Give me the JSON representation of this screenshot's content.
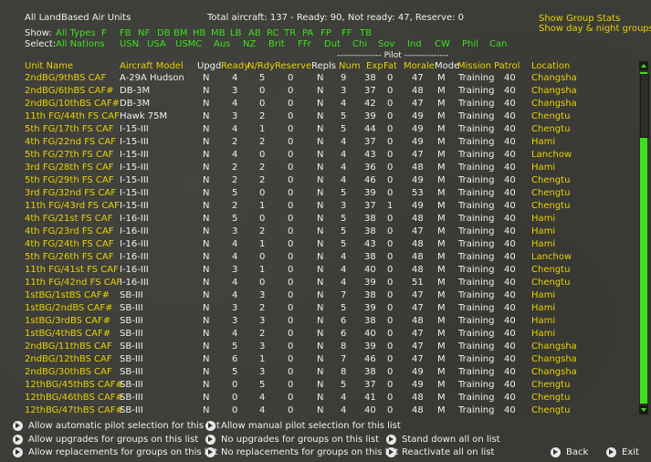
{
  "header": {
    "title": "All LandBased Air Units",
    "summary": "Total aircraft: 137 - Ready: 90, Not ready: 47, Reserve: 0",
    "show_group_stats": "Show Group Stats",
    "show_day_night": "Show day & night groups",
    "show_label": "Show:",
    "select_label": "Select:",
    "show_filters": [
      "All Types",
      "F",
      "FB",
      "NF",
      "DB",
      "BM",
      "HB",
      "MB",
      "LB",
      "AB",
      "RC",
      "TR",
      "PA",
      "FP",
      "FF",
      "TB"
    ],
    "select_filters": [
      "All Nations",
      "USN",
      "USA",
      "USMC",
      "Aus",
      "NZ",
      "Brit",
      "FFr",
      "Dut",
      "Chi",
      "Sov",
      "Ind",
      "CW",
      "Phil",
      "Can"
    ],
    "pilot_group": "--------------- Pilot ---------------"
  },
  "columns": {
    "unit": "Unit Name",
    "aircraft": "Aircraft Model",
    "upgd": "Upgd",
    "ready": "Ready",
    "nrdy": "N/Rdy",
    "reserve": "Reserve",
    "repls": "Repls",
    "num": "Num",
    "exp": "Exp",
    "fat": "Fat",
    "morale": "Morale",
    "mode": "Mode",
    "mission": "Mission",
    "patrol": "Patrol",
    "location": "Location"
  },
  "rows": [
    {
      "unit": "2ndBG/9thBS CAF",
      "aircraft": "A-29A Hudson",
      "upgd": "N",
      "ready": "4",
      "nrdy": "5",
      "reserve": "0",
      "repls": "N",
      "num": "9",
      "exp": "38",
      "fat": "0",
      "morale": "47",
      "mode": "M",
      "mission": "Training",
      "patrol": "40",
      "location": "Changsha"
    },
    {
      "unit": "2ndBG/6thBS CAF#",
      "aircraft": "DB-3M",
      "upgd": "N",
      "ready": "3",
      "nrdy": "0",
      "reserve": "0",
      "repls": "N",
      "num": "3",
      "exp": "37",
      "fat": "0",
      "morale": "48",
      "mode": "M",
      "mission": "Training",
      "patrol": "40",
      "location": "Changsha"
    },
    {
      "unit": "2ndBG/10thBS CAF#",
      "aircraft": "DB-3M",
      "upgd": "N",
      "ready": "4",
      "nrdy": "0",
      "reserve": "0",
      "repls": "N",
      "num": "4",
      "exp": "42",
      "fat": "0",
      "morale": "47",
      "mode": "M",
      "mission": "Training",
      "patrol": "40",
      "location": "Changsha"
    },
    {
      "unit": "11th FG/44th FS CAF",
      "aircraft": "Hawk 75M",
      "upgd": "N",
      "ready": "3",
      "nrdy": "2",
      "reserve": "0",
      "repls": "N",
      "num": "5",
      "exp": "39",
      "fat": "0",
      "morale": "49",
      "mode": "M",
      "mission": "Training",
      "patrol": "40",
      "location": "Chengtu"
    },
    {
      "unit": "5th FG/17th FS CAF",
      "aircraft": "I-15-III",
      "upgd": "N",
      "ready": "4",
      "nrdy": "1",
      "reserve": "0",
      "repls": "N",
      "num": "5",
      "exp": "44",
      "fat": "0",
      "morale": "49",
      "mode": "M",
      "mission": "Training",
      "patrol": "40",
      "location": "Chengtu"
    },
    {
      "unit": "4th FG/22nd FS CAF",
      "aircraft": "I-15-III",
      "upgd": "N",
      "ready": "2",
      "nrdy": "2",
      "reserve": "0",
      "repls": "N",
      "num": "4",
      "exp": "37",
      "fat": "0",
      "morale": "49",
      "mode": "M",
      "mission": "Training",
      "patrol": "40",
      "location": "Hami"
    },
    {
      "unit": "5th FG/27th FS CAF",
      "aircraft": "I-15-III",
      "upgd": "N",
      "ready": "4",
      "nrdy": "0",
      "reserve": "0",
      "repls": "N",
      "num": "4",
      "exp": "43",
      "fat": "0",
      "morale": "47",
      "mode": "M",
      "mission": "Training",
      "patrol": "40",
      "location": "Lanchow"
    },
    {
      "unit": "3rd FG/28th FS CAF",
      "aircraft": "I-15-III",
      "upgd": "N",
      "ready": "2",
      "nrdy": "2",
      "reserve": "0",
      "repls": "N",
      "num": "4",
      "exp": "36",
      "fat": "0",
      "morale": "48",
      "mode": "M",
      "mission": "Training",
      "patrol": "40",
      "location": "Hami"
    },
    {
      "unit": "5th FG/29th FS CAF",
      "aircraft": "I-15-III",
      "upgd": "N",
      "ready": "2",
      "nrdy": "2",
      "reserve": "0",
      "repls": "N",
      "num": "4",
      "exp": "46",
      "fat": "0",
      "morale": "49",
      "mode": "M",
      "mission": "Training",
      "patrol": "40",
      "location": "Chengtu"
    },
    {
      "unit": "3rd FG/32nd FS CAF",
      "aircraft": "I-15-III",
      "upgd": "N",
      "ready": "5",
      "nrdy": "0",
      "reserve": "0",
      "repls": "N",
      "num": "5",
      "exp": "39",
      "fat": "0",
      "morale": "53",
      "mode": "M",
      "mission": "Training",
      "patrol": "40",
      "location": "Chengtu"
    },
    {
      "unit": "11th FG/43rd FS CAF",
      "aircraft": "I-15-III",
      "upgd": "N",
      "ready": "2",
      "nrdy": "1",
      "reserve": "0",
      "repls": "N",
      "num": "3",
      "exp": "37",
      "fat": "1",
      "morale": "49",
      "mode": "M",
      "mission": "Training",
      "patrol": "40",
      "location": "Chengtu"
    },
    {
      "unit": "4th FG/21st FS CAF",
      "aircraft": "I-16-III",
      "upgd": "N",
      "ready": "5",
      "nrdy": "0",
      "reserve": "0",
      "repls": "N",
      "num": "5",
      "exp": "38",
      "fat": "0",
      "morale": "48",
      "mode": "M",
      "mission": "Training",
      "patrol": "40",
      "location": "Hami"
    },
    {
      "unit": "4th FG/23rd FS CAF",
      "aircraft": "I-16-III",
      "upgd": "N",
      "ready": "3",
      "nrdy": "2",
      "reserve": "0",
      "repls": "N",
      "num": "5",
      "exp": "38",
      "fat": "0",
      "morale": "47",
      "mode": "M",
      "mission": "Training",
      "patrol": "40",
      "location": "Hami"
    },
    {
      "unit": "4th FG/24th FS CAF",
      "aircraft": "I-16-III",
      "upgd": "N",
      "ready": "4",
      "nrdy": "1",
      "reserve": "0",
      "repls": "N",
      "num": "5",
      "exp": "43",
      "fat": "0",
      "morale": "48",
      "mode": "M",
      "mission": "Training",
      "patrol": "40",
      "location": "Hami"
    },
    {
      "unit": "5th FG/26th FS CAF",
      "aircraft": "I-16-III",
      "upgd": "N",
      "ready": "4",
      "nrdy": "0",
      "reserve": "0",
      "repls": "N",
      "num": "4",
      "exp": "38",
      "fat": "0",
      "morale": "48",
      "mode": "M",
      "mission": "Training",
      "patrol": "40",
      "location": "Lanchow"
    },
    {
      "unit": "11th FG/41st FS CAF",
      "aircraft": "I-16-III",
      "upgd": "N",
      "ready": "3",
      "nrdy": "1",
      "reserve": "0",
      "repls": "N",
      "num": "4",
      "exp": "40",
      "fat": "0",
      "morale": "48",
      "mode": "M",
      "mission": "Training",
      "patrol": "40",
      "location": "Chengtu"
    },
    {
      "unit": "11th FG/42nd FS CAF",
      "aircraft": "I-16-III",
      "upgd": "N",
      "ready": "4",
      "nrdy": "0",
      "reserve": "0",
      "repls": "N",
      "num": "4",
      "exp": "39",
      "fat": "0",
      "morale": "51",
      "mode": "M",
      "mission": "Training",
      "patrol": "40",
      "location": "Chengtu"
    },
    {
      "unit": "1stBG/1stBS CAF#",
      "aircraft": "SB-III",
      "upgd": "N",
      "ready": "4",
      "nrdy": "3",
      "reserve": "0",
      "repls": "N",
      "num": "7",
      "exp": "38",
      "fat": "0",
      "morale": "47",
      "mode": "M",
      "mission": "Training",
      "patrol": "40",
      "location": "Hami"
    },
    {
      "unit": "1stBG/2ndBS CAF#",
      "aircraft": "SB-III",
      "upgd": "N",
      "ready": "3",
      "nrdy": "2",
      "reserve": "0",
      "repls": "N",
      "num": "5",
      "exp": "39",
      "fat": "0",
      "morale": "47",
      "mode": "M",
      "mission": "Training",
      "patrol": "40",
      "location": "Hami"
    },
    {
      "unit": "1stBG/3rdBS CAF#",
      "aircraft": "SB-III",
      "upgd": "N",
      "ready": "3",
      "nrdy": "3",
      "reserve": "0",
      "repls": "N",
      "num": "6",
      "exp": "38",
      "fat": "0",
      "morale": "48",
      "mode": "M",
      "mission": "Training",
      "patrol": "40",
      "location": "Hami"
    },
    {
      "unit": "1stBG/4thBS CAF#",
      "aircraft": "SB-III",
      "upgd": "N",
      "ready": "4",
      "nrdy": "2",
      "reserve": "0",
      "repls": "N",
      "num": "6",
      "exp": "40",
      "fat": "0",
      "morale": "47",
      "mode": "M",
      "mission": "Training",
      "patrol": "40",
      "location": "Hami"
    },
    {
      "unit": "2ndBG/11thBS CAF",
      "aircraft": "SB-III",
      "upgd": "N",
      "ready": "5",
      "nrdy": "3",
      "reserve": "0",
      "repls": "N",
      "num": "8",
      "exp": "39",
      "fat": "0",
      "morale": "47",
      "mode": "M",
      "mission": "Training",
      "patrol": "40",
      "location": "Changsha"
    },
    {
      "unit": "2ndBG/12thBS CAF",
      "aircraft": "SB-III",
      "upgd": "N",
      "ready": "6",
      "nrdy": "1",
      "reserve": "0",
      "repls": "N",
      "num": "7",
      "exp": "46",
      "fat": "0",
      "morale": "47",
      "mode": "M",
      "mission": "Training",
      "patrol": "40",
      "location": "Changsha"
    },
    {
      "unit": "2ndBG/30thBS CAF",
      "aircraft": "SB-III",
      "upgd": "N",
      "ready": "5",
      "nrdy": "3",
      "reserve": "0",
      "repls": "N",
      "num": "8",
      "exp": "38",
      "fat": "0",
      "morale": "49",
      "mode": "M",
      "mission": "Training",
      "patrol": "40",
      "location": "Changsha"
    },
    {
      "unit": "12thBG/45thBS CAF#",
      "aircraft": "SB-III",
      "upgd": "N",
      "ready": "0",
      "nrdy": "5",
      "reserve": "0",
      "repls": "N",
      "num": "5",
      "exp": "37",
      "fat": "0",
      "morale": "49",
      "mode": "M",
      "mission": "Training",
      "patrol": "40",
      "location": "Chengtu"
    },
    {
      "unit": "12thBG/46thBS CAF#",
      "aircraft": "SB-III",
      "upgd": "N",
      "ready": "0",
      "nrdy": "4",
      "reserve": "0",
      "repls": "N",
      "num": "4",
      "exp": "41",
      "fat": "0",
      "morale": "48",
      "mode": "M",
      "mission": "Training",
      "patrol": "40",
      "location": "Chengtu"
    },
    {
      "unit": "12thBG/47thBS CAF#",
      "aircraft": "SB-III",
      "upgd": "N",
      "ready": "0",
      "nrdy": "4",
      "reserve": "0",
      "repls": "N",
      "num": "4",
      "exp": "40",
      "fat": "0",
      "morale": "48",
      "mode": "M",
      "mission": "Training",
      "patrol": "40",
      "location": "Chengtu"
    }
  ],
  "options": {
    "auto_pilot": "Allow automatic pilot selection for this list",
    "manual_pilot": "Allow manual pilot selection for this list",
    "allow_upgrades": "Allow upgrades for groups on this list",
    "no_upgrades": "No upgrades for groups on this list",
    "stand_down": "Stand down all on list",
    "allow_replacements": "Allow replacements for groups on this list",
    "no_replacements": "No replacements for groups on this list",
    "reactivate": "Reactivate all on list",
    "back": "Back",
    "exit": "Exit"
  }
}
